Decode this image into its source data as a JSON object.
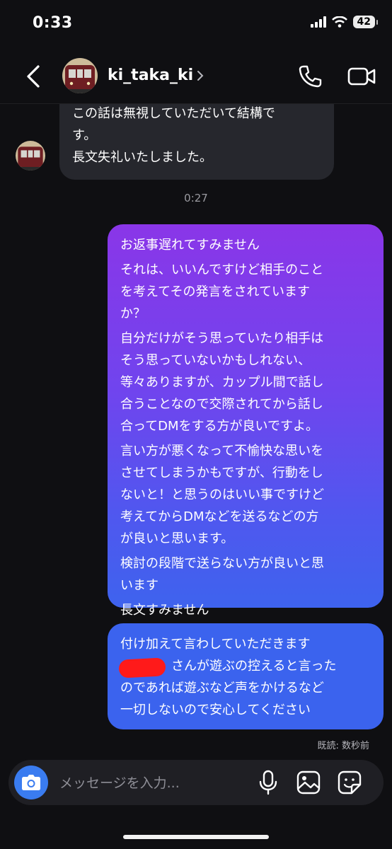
{
  "status_bar": {
    "time": "0:33",
    "battery": "42"
  },
  "header": {
    "username": "ki_taka_ki"
  },
  "chat": {
    "incoming": {
      "lines": [
        "この話は無視していただいて結構で",
        "す。",
        "長文失礼いたしました。"
      ]
    },
    "timestamp": "0:27",
    "outgoing_1": {
      "paragraphs": [
        "お返事遅れてすみません",
        "それは、いいんですけど相手のこと\nを考えてその発言をされています\nか？",
        "自分だけがそう思っていたり相手は\nそう思っていないかもしれない、\n等々ありますが、カップル間で話し\n合うことなので交際されてから話し\n合ってDMをする方が良いですよ。",
        "言い方が悪くなって不愉快な思いを\nさせてしまうかもですが、行動をし\nないと！と思うのはいい事ですけど\n考えてからDMなどを送るなどの方\nが良いと思います。",
        "検討の段階で送らない方が良いと思\nいます",
        "長文すみません"
      ]
    },
    "outgoing_2": {
      "text": "付け加えて言わしていただきます\n　　　　さんが遊ぶの控えると言った\nのであれば遊ぶなど声をかけるなど\n一切しないので安心してください"
    },
    "read_receipt": "既読: 数秒前"
  },
  "composer": {
    "placeholder": "メッセージを入力..."
  },
  "colors": {
    "accent": "#3a7cf0",
    "bubble_incoming": "#26272d",
    "redaction": "#ff1a1a"
  }
}
